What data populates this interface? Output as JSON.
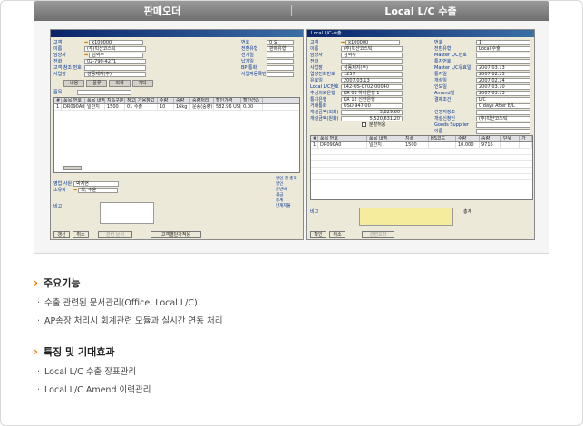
{
  "header": {
    "left_title": "판매오더",
    "right_title": "Local L/C 수출"
  },
  "shot1": {
    "fields": [
      {
        "label": "고객",
        "value": "k100000"
      },
      {
        "label": "이름",
        "value": "(주)빅샨코스틱"
      },
      {
        "label": "담당자",
        "value": "김억수"
      },
      {
        "label": "전화",
        "value": "02-790-4271"
      },
      {
        "label": "고객 참조 번호",
        "value": ""
      },
      {
        "label": "사업장",
        "value": "성동제지(주)"
      }
    ],
    "right_fields": [
      "번호",
      "전환유형",
      "전기일",
      "납기일",
      "BP 통화",
      "사업자등록번호"
    ],
    "right_values": [
      "0 요",
      "판매유형",
      "",
      "",
      "",
      ""
    ],
    "tabs": [
      "내용",
      "물류",
      "회계",
      "기타"
    ],
    "item_type_label": "품목",
    "grid_headers": [
      "#",
      "품목 번호",
      "품목 내역",
      "지속구분",
      "창고",
      "가용창고",
      "수량",
      "중량",
      "중량처리",
      "할인가격",
      "할인(%)"
    ],
    "grid_row": [
      "1",
      "DR090A0",
      "일반지",
      "1500",
      "01 수출",
      "10",
      "16kg",
      "운송(중량)",
      "582.96 USD",
      "0.00"
    ],
    "sales_rep_label": "영업 사원",
    "sales_rep_value": "박지현",
    "owner_label": "소유자",
    "owner_value": "최, 수윤",
    "remarks_label": "비고",
    "right_summary": [
      "할인 전 총계",
      "할인",
      "운반비",
      "세금",
      "총계",
      "단계지불"
    ],
    "buttons": [
      "갱신",
      "취소",
      "관련 문서",
      "고객별단가적용"
    ]
  },
  "shot2": {
    "window_title": "Local L/C-수출",
    "fields": [
      {
        "label": "고객",
        "value": "k100000"
      },
      {
        "label": "이름",
        "value": "(주)빅샨코스틱"
      },
      {
        "label": "담당자",
        "value": "김억수"
      },
      {
        "label": "전화",
        "value": ""
      },
      {
        "label": "사업장",
        "value": "성동제지(주)"
      },
      {
        "label": "업장전화번호",
        "value": "1257"
      },
      {
        "label": "유효일",
        "value": "2007.03.13"
      },
      {
        "label": "Local L/C번호",
        "value": "L42-US-0702-00040"
      },
      {
        "label": "추심의뢰은행",
        "value": "KR 03 하나은행 1"
      },
      {
        "label": "통지은행",
        "value": "KR 12 신한은행"
      },
      {
        "label": "거래통화",
        "value": "USD 947.00"
      },
      {
        "label": "개설금액(외화)",
        "value": "5,829.60"
      },
      {
        "label": "개설금액(원화)",
        "value": "5,520,631.20"
      }
    ],
    "partial_label": "분할허용",
    "right_fields": [
      {
        "label": "번호",
        "value": "1"
      },
      {
        "label": "전환유형",
        "value": "Local 수출"
      },
      {
        "label": "Master L/C번호",
        "value": ""
      },
      {
        "label": "통지번호",
        "value": ""
      },
      {
        "label": "Master L/C유효일",
        "value": "2007.03.13"
      },
      {
        "label": "통지일",
        "value": "2007.02.15"
      },
      {
        "label": "개설일",
        "value": "2007.02.14"
      },
      {
        "label": "인도일",
        "value": "2007.03.10"
      },
      {
        "label": "Amend일",
        "value": "2007.03.13"
      },
      {
        "label": "결제조건",
        "value": "L/C"
      },
      {
        "label": "",
        "value": "0 days After B/L"
      },
      {
        "label": "건명지정조",
        "value": ""
      },
      {
        "label": "개설신청인",
        "value": "(주)빅샨코스틱"
      },
      {
        "label": "Goods Supplier",
        "value": ""
      },
      {
        "label": "이름",
        "value": ""
      }
    ],
    "grid_headers": [
      "#",
      "품목 번호",
      "품목 내역",
      "지폭",
      "HS코드",
      "수량",
      "중량",
      "단위",
      "가"
    ],
    "grid_row": [
      "1",
      "DR090A0",
      "일반지",
      "1500",
      "",
      "10.000",
      "9716",
      "",
      ""
    ],
    "remarks_label": "비고",
    "total_label": "총계",
    "buttons": [
      "확인",
      "취소",
      "관련오더"
    ]
  },
  "features": {
    "title": "주요기능",
    "items": [
      "수출 관련된 문서관리(Office, Local L/C)",
      "AP송장 처리시 회계관련 모듈과 실시간 연동 처리"
    ]
  },
  "benefits": {
    "title": "특징 및 기대효과",
    "items": [
      "Local L/C 수출 장표관리",
      "Local L/C Amend 이력관리"
    ]
  },
  "colors": {
    "accent": "#e87a00",
    "header_gray": "#7a7a7a",
    "sap_title": "#0a246a",
    "remarks_yellow": "#f6ec9e"
  }
}
